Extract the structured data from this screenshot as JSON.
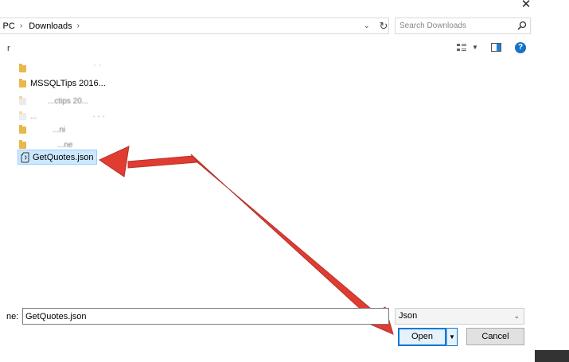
{
  "window": {
    "close_glyph": "✕"
  },
  "address": {
    "crumbs": [
      "s PC",
      "Downloads"
    ],
    "separator": "›",
    "dropdown_glyph": "⌄",
    "refresh_glyph": "↻"
  },
  "search": {
    "placeholder": "Search Downloads",
    "icon": "search-icon"
  },
  "sidebar": {
    "stub_label": "r"
  },
  "toolbar": {
    "view_icon": "view-options-icon",
    "preview_icon": "preview-pane-icon",
    "help_label": "?"
  },
  "files": {
    "items": [
      {
        "type": "folder",
        "label": ""
      },
      {
        "type": "folder",
        "label": "MSSQLTips 2016..."
      },
      {
        "type": "folder",
        "label": "...ctips 20..."
      },
      {
        "type": "folder",
        "label": "..."
      },
      {
        "type": "folder",
        "label": "...ni"
      },
      {
        "type": "folder",
        "label": "...ne"
      },
      {
        "type": "json",
        "label": "GetQuotes.json",
        "selected": true
      }
    ]
  },
  "footer": {
    "filename_label": "ne:",
    "filename_value": "GetQuotes.json",
    "filetype_value": "Json",
    "open_label": "Open",
    "cancel_label": "Cancel",
    "split_glyph": "▼"
  },
  "colors": {
    "arrow": "#e03c31",
    "accent": "#0078d7",
    "selection": "#cce8ff"
  }
}
